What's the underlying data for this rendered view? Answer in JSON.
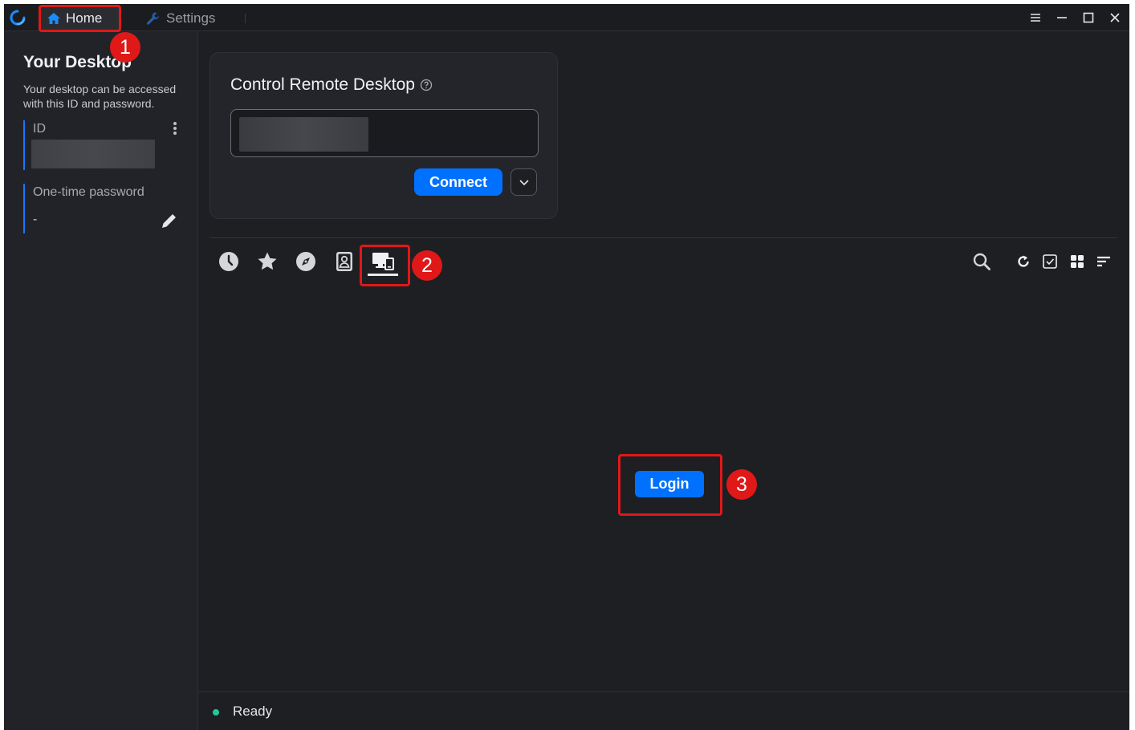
{
  "window": {
    "tabs": [
      {
        "label": "Home",
        "icon": "home-icon",
        "active": true
      },
      {
        "label": "Settings",
        "icon": "wrench-icon",
        "active": false
      }
    ]
  },
  "left_panel": {
    "title": "Your Desktop",
    "description": "Your desktop can be accessed with this ID and password.",
    "id_label": "ID",
    "password_label": "One-time password",
    "password_value": "-"
  },
  "control_card": {
    "title": "Control Remote Desktop",
    "input_value": "",
    "connect_label": "Connect"
  },
  "toolbar": {
    "left_icons": [
      "history-icon",
      "star-icon",
      "compass-icon",
      "address-book-icon",
      "devices-icon"
    ],
    "right_icons": [
      "search-icon",
      "refresh-icon",
      "checkbox-icon",
      "grid-view-icon",
      "sort-icon"
    ],
    "active_tab": "devices-icon"
  },
  "main": {
    "login_label": "Login"
  },
  "status": {
    "text": "Ready",
    "dot_color": "#20c997"
  },
  "annotations": [
    "1",
    "2",
    "3"
  ],
  "colors": {
    "accent": "#0071ff",
    "highlight": "#e01818"
  }
}
